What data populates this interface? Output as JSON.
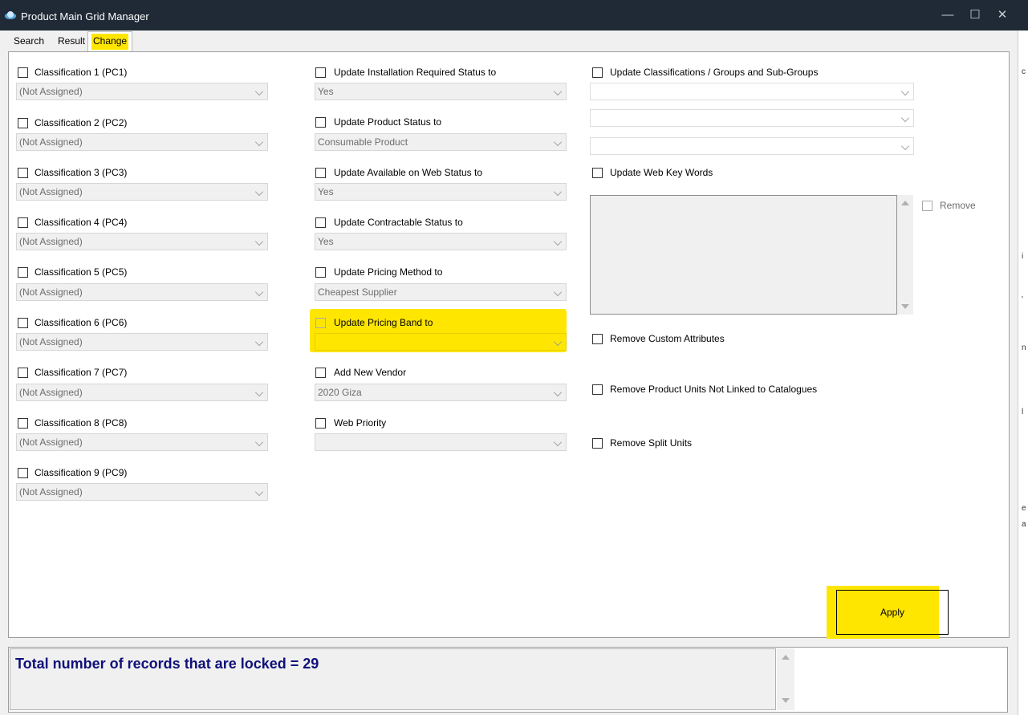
{
  "window": {
    "title": "Product Main Grid Manager",
    "minimize": "—",
    "maximize": "☐",
    "close": "✕"
  },
  "tabs": [
    "Search",
    "Result",
    "Change"
  ],
  "right_strip": [
    "c",
    "i",
    "'",
    "n",
    "l",
    "e",
    "a"
  ],
  "classifications": [
    {
      "label": "Classification 1 (PC1)",
      "value": "(Not Assigned)"
    },
    {
      "label": "Classification 2 (PC2)",
      "value": "(Not Assigned)"
    },
    {
      "label": "Classification 3 (PC3)",
      "value": "(Not Assigned)"
    },
    {
      "label": "Classification 4 (PC4)",
      "value": "(Not Assigned)"
    },
    {
      "label": "Classification 5 (PC5)",
      "value": "(Not Assigned)"
    },
    {
      "label": "Classification 6 (PC6)",
      "value": "(Not Assigned)"
    },
    {
      "label": "Classification 7 (PC7)",
      "value": "(Not Assigned)"
    },
    {
      "label": "Classification 8 (PC8)",
      "value": "(Not Assigned)"
    },
    {
      "label": "Classification 9 (PC9)",
      "value": "(Not Assigned)"
    }
  ],
  "updates": [
    {
      "label": "Update Installation Required Status to",
      "value": "Yes"
    },
    {
      "label": "Update Product Status to",
      "value": "Consumable Product"
    },
    {
      "label": "Update Available on Web Status to",
      "value": "Yes"
    },
    {
      "label": "Update Contractable Status to",
      "value": "Yes"
    },
    {
      "label": "Update Pricing Method to",
      "value": "Cheapest Supplier"
    },
    {
      "label": "Update Pricing Band to",
      "value": ""
    },
    {
      "label": "Add New Vendor",
      "value": "2020 Giza"
    },
    {
      "label": "Web Priority",
      "value": ""
    }
  ],
  "right_column": {
    "groups_label": "Update Classifications / Groups and Sub-Groups",
    "keywords_label": "Update Web Key Words",
    "remove_label": "Remove",
    "remove_custom_attributes": "Remove Custom Attributes",
    "remove_product_units": "Remove Product Units Not Linked to Catalogues",
    "remove_split_units": "Remove Split Units"
  },
  "apply_label": "Apply",
  "status_text": "Total number of records that are locked = 29",
  "colors": {
    "highlight": "#ffe600",
    "status_text": "#10107a",
    "titlebar": "#1f2a36"
  }
}
